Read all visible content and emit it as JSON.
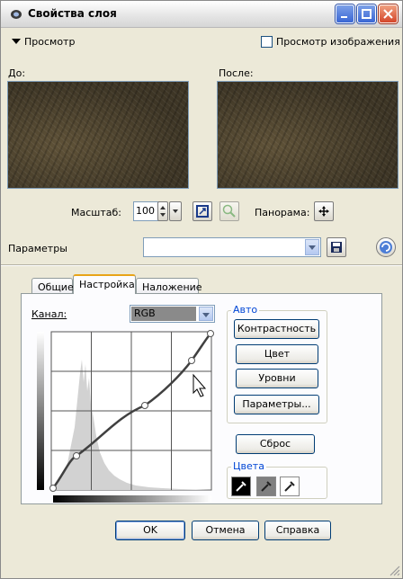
{
  "window": {
    "title": "Свойства слоя"
  },
  "preview_section": {
    "header": "Просмотр",
    "image_preview_label": "Просмотр изображения",
    "before_label": "До:",
    "after_label": "После:"
  },
  "zoom": {
    "label": "Масштаб:",
    "value": "100",
    "pan_label": "Панорама:"
  },
  "presets": {
    "label": "Параметры",
    "value": ""
  },
  "tabs": [
    {
      "label": "Общие"
    },
    {
      "label": "Настройка"
    },
    {
      "label": "Наложение"
    }
  ],
  "channel": {
    "label": "Канал:",
    "value": "RGB"
  },
  "auto_group": {
    "title": "Авто",
    "buttons": [
      "Контрастность",
      "Цвет",
      "Уровни",
      "Параметры..."
    ]
  },
  "reset_label": "Сброс",
  "colors_group": {
    "title": "Цвета"
  },
  "footer": {
    "ok": "OK",
    "cancel": "Отмена",
    "help": "Справка"
  },
  "colors": {
    "accent": "#0046d5",
    "active_tab": "#e8a418",
    "curve": "#404040"
  }
}
